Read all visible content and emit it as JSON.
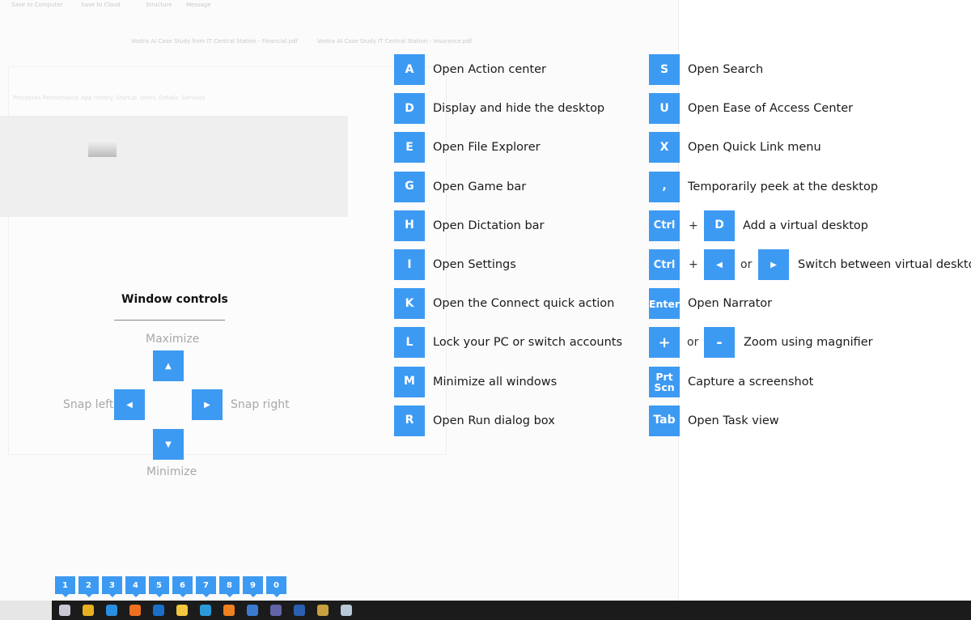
{
  "background": {
    "toolbar": [
      "Save to Computer",
      "Save to Cloud",
      "Structure",
      "Message"
    ],
    "tabs": [
      "Processes",
      "Performance",
      "App history",
      "Startup",
      "Users",
      "Details",
      "Services"
    ],
    "attachments": [
      "Vostra AI Case Study from IT Central Station - Financial.pdf",
      "Vostra AI Case Study IT Central Station - Insurance.pdf"
    ]
  },
  "accent_color": "#3d9af2",
  "left_shortcuts": [
    {
      "key": "A",
      "label": "Open Action center"
    },
    {
      "key": "D",
      "label": "Display and hide the desktop"
    },
    {
      "key": "E",
      "label": "Open File Explorer"
    },
    {
      "key": "G",
      "label": "Open Game bar"
    },
    {
      "key": "H",
      "label": "Open Dictation bar"
    },
    {
      "key": "I",
      "label": "Open Settings"
    },
    {
      "key": "K",
      "label": "Open the Connect quick action"
    },
    {
      "key": "L",
      "label": "Lock your PC or switch accounts"
    },
    {
      "key": "M",
      "label": "Minimize all windows"
    },
    {
      "key": "R",
      "label": "Open Run dialog box"
    }
  ],
  "right_shortcuts": {
    "s": {
      "key": "S",
      "label": "Open Search"
    },
    "u": {
      "key": "U",
      "label": "Open Ease of Access Center"
    },
    "x": {
      "key": "X",
      "label": "Open Quick Link menu"
    },
    "comma": {
      "key": ",",
      "label": "Temporarily peek at the desktop"
    },
    "ctrl_d": {
      "key1": "Ctrl",
      "plus": "+",
      "key2": "D",
      "label": "Add a virtual desktop"
    },
    "ctrl_arrows": {
      "key1": "Ctrl",
      "plus": "+",
      "key2": "◀",
      "or": "or",
      "key3": "▶",
      "label": "Switch between virtual desktops"
    },
    "enter": {
      "key": "Enter",
      "label": "Open Narrator"
    },
    "magnifier": {
      "key1": "+",
      "or": "or",
      "key2": "-",
      "label": "Zoom using magnifier"
    },
    "prtscn": {
      "key": "Prt Scn",
      "label": "Capture a screenshot"
    },
    "tab": {
      "key": "Tab",
      "label": "Open Task view"
    }
  },
  "window_controls": {
    "title": "Window controls",
    "maximize": "Maximize",
    "minimize": "Minimize",
    "snap_left": "Snap left",
    "snap_right": "Snap right",
    "up": "▲",
    "down": "▼",
    "left": "◀",
    "right": "▶"
  },
  "taskbar": {
    "badges": [
      "1",
      "2",
      "3",
      "4",
      "5",
      "6",
      "7",
      "8",
      "9",
      "0"
    ],
    "icons": [
      "app-icon",
      "chrome-icon",
      "internet-explorer-icon",
      "firefox-icon",
      "outlook-icon",
      "file-explorer-icon",
      "edge-icon",
      "search-everything-icon",
      "solitaire-icon",
      "teams-icon",
      "word-icon",
      "photo-app-icon",
      "remote-desktop-icon"
    ]
  }
}
